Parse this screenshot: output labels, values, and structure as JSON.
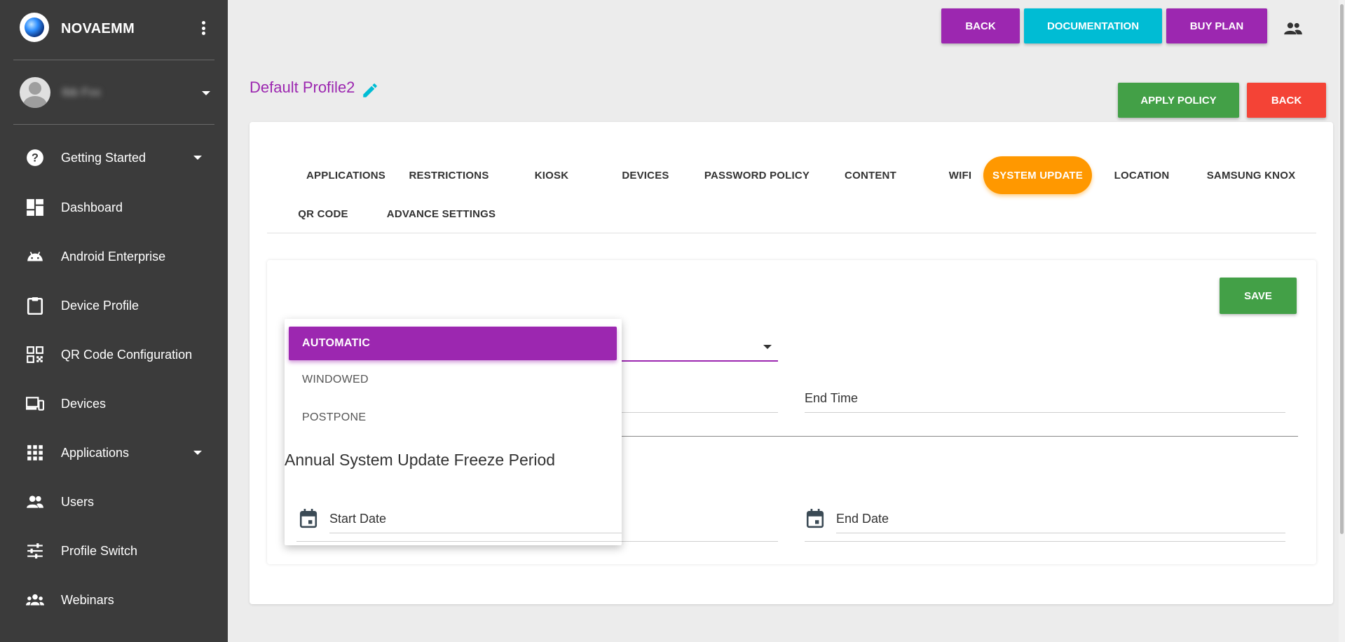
{
  "app": {
    "name": "NOVAEMM"
  },
  "user": {
    "name": "Ibb Fxx"
  },
  "sidebar": {
    "items": [
      {
        "label": "Getting Started",
        "icon": "help-circle-icon",
        "has_caret": true
      },
      {
        "label": "Dashboard",
        "icon": "dashboard-icon",
        "has_caret": false
      },
      {
        "label": "Android Enterprise",
        "icon": "android-icon",
        "has_caret": false
      },
      {
        "label": "Device Profile",
        "icon": "clipboard-icon",
        "has_caret": false
      },
      {
        "label": "QR Code Configuration",
        "icon": "qr-code-icon",
        "has_caret": false
      },
      {
        "label": "Devices",
        "icon": "devices-icon",
        "has_caret": false
      },
      {
        "label": "Applications",
        "icon": "apps-grid-icon",
        "has_caret": true
      },
      {
        "label": "Users",
        "icon": "users-icon",
        "has_caret": false
      },
      {
        "label": "Profile Switch",
        "icon": "tune-icon",
        "has_caret": false
      },
      {
        "label": "Webinars",
        "icon": "group-icon",
        "has_caret": false
      }
    ]
  },
  "header": {
    "back_label": "BACK",
    "documentation_label": "DOCUMENTATION",
    "buy_plan_label": "BUY PLAN",
    "colors": {
      "back": "#9c27b0",
      "documentation": "#00bcd4",
      "buy_plan": "#9c27b0"
    }
  },
  "profile": {
    "title": "Default Profile2",
    "apply_policy_label": "APPLY POLICY",
    "back_label": "BACK"
  },
  "tabs": [
    {
      "label": "APPLICATIONS"
    },
    {
      "label": "RESTRICTIONS"
    },
    {
      "label": "KIOSK"
    },
    {
      "label": "DEVICES"
    },
    {
      "label": "PASSWORD POLICY"
    },
    {
      "label": "CONTENT"
    },
    {
      "label": "WIFI"
    },
    {
      "label": "SYSTEM UPDATE",
      "active": true
    },
    {
      "label": "LOCATION"
    },
    {
      "label": "SAMSUNG KNOX"
    },
    {
      "label": "QR CODE"
    },
    {
      "label": "ADVANCE SETTINGS"
    }
  ],
  "system_update": {
    "save_label": "SAVE",
    "update_type_options": [
      "AUTOMATIC",
      "WINDOWED",
      "POSTPONE"
    ],
    "update_type_selected": "AUTOMATIC",
    "end_time_label": "End Time",
    "freeze_heading": "Annual System Update Freeze Period",
    "start_date_label": "Start Date",
    "end_date_label": "End Date"
  }
}
